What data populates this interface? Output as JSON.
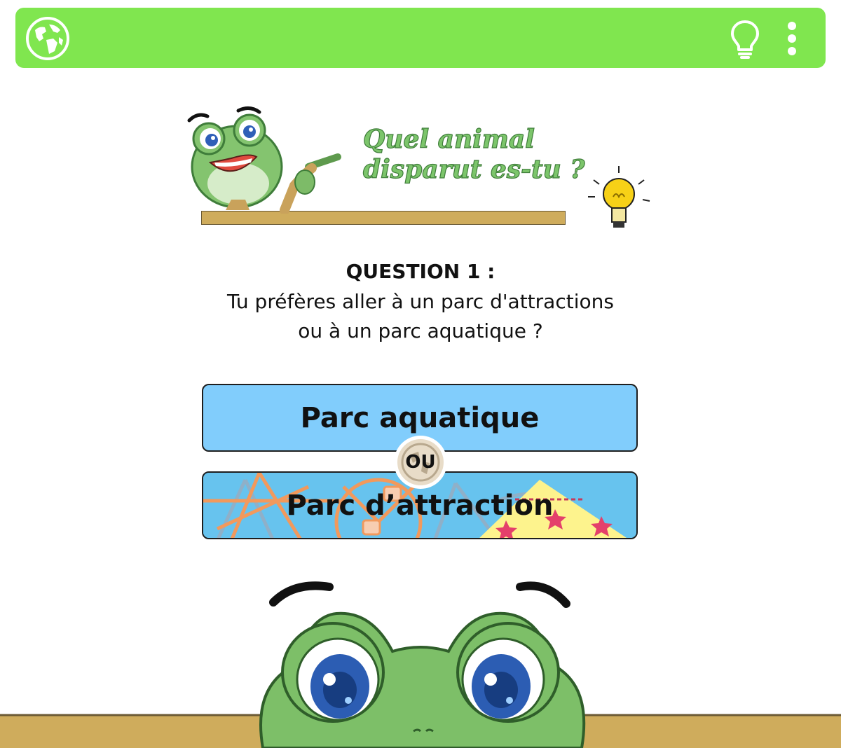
{
  "topbar": {
    "color": "#80e64f",
    "left_icon": "globe-icon",
    "right_icons": [
      "lightbulb-icon",
      "more-vertical-icon"
    ]
  },
  "banner": {
    "title_line1": "Quel animal",
    "title_line2": "disparut es-tu ?"
  },
  "question": {
    "title": "QUESTION 1 :",
    "text_line1": "Tu préfères aller à un parc d'attractions",
    "text_line2": "ou à un parc aquatique ?"
  },
  "choices": [
    {
      "label": "Parc aquatique",
      "color": "#81cdfc"
    },
    {
      "label": "Parc d’attraction",
      "color": "#67c3ee"
    }
  ],
  "separator": {
    "label": "OU"
  }
}
